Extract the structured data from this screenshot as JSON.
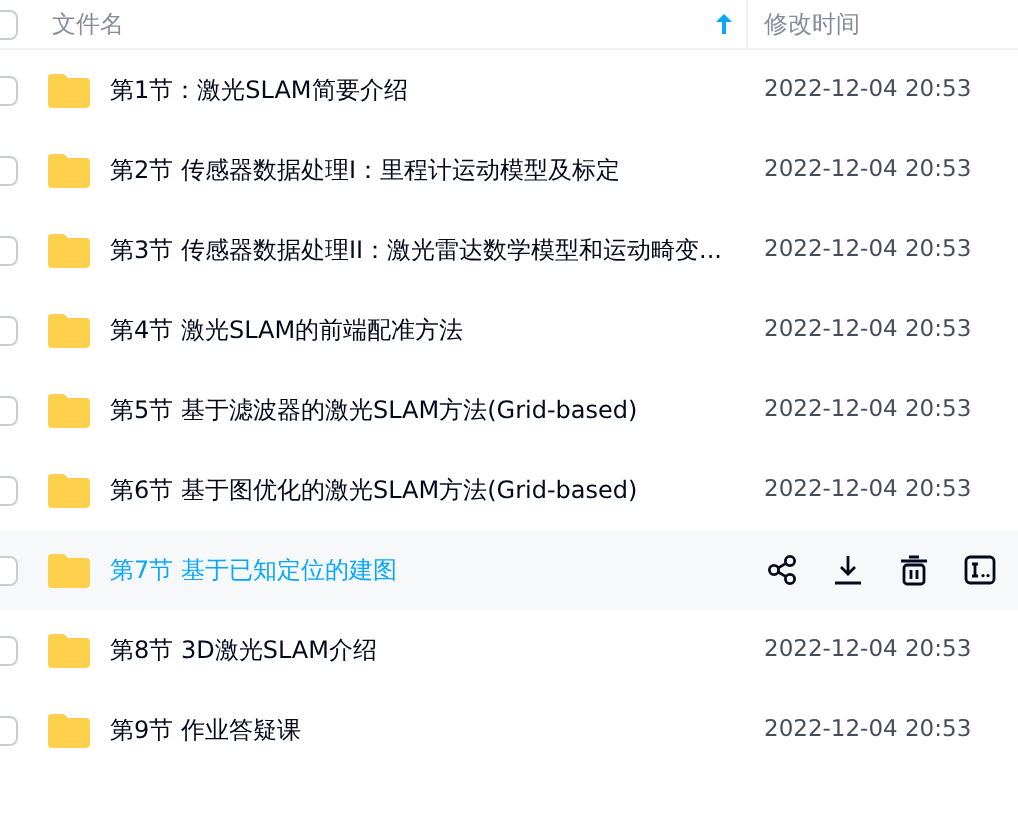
{
  "header": {
    "select_all": {
      "checked": false
    },
    "name_column": "文件名",
    "sort_ascending": true,
    "time_column": "修改时间"
  },
  "rows": [
    {
      "name": "第1节：激光SLAM简要介绍",
      "time": "2022-12-04 20:53",
      "checked": false,
      "hovered": false
    },
    {
      "name": "第2节 传感器数据处理I：里程计运动模型及标定",
      "time": "2022-12-04 20:53",
      "checked": false,
      "hovered": false
    },
    {
      "name": "第3节 传感器数据处理II：激光雷达数学模型和运动畸变...",
      "time": "2022-12-04 20:53",
      "checked": false,
      "hovered": false
    },
    {
      "name": "第4节 激光SLAM的前端配准方法",
      "time": "2022-12-04 20:53",
      "checked": false,
      "hovered": false
    },
    {
      "name": "第5节 基于滤波器的激光SLAM方法(Grid-based)",
      "time": "2022-12-04 20:53",
      "checked": false,
      "hovered": false
    },
    {
      "name": "第6节 基于图优化的激光SLAM方法(Grid-based)",
      "time": "2022-12-04 20:53",
      "checked": false,
      "hovered": false
    },
    {
      "name": "第7节 基于已知定位的建图",
      "checked": false,
      "hovered": true
    },
    {
      "name": "第8节 3D激光SLAM介绍",
      "time": "2022-12-04 20:53",
      "checked": false,
      "hovered": false
    },
    {
      "name": "第9节 作业答疑课",
      "time": "2022-12-04 20:53",
      "checked": false,
      "hovered": false
    }
  ]
}
